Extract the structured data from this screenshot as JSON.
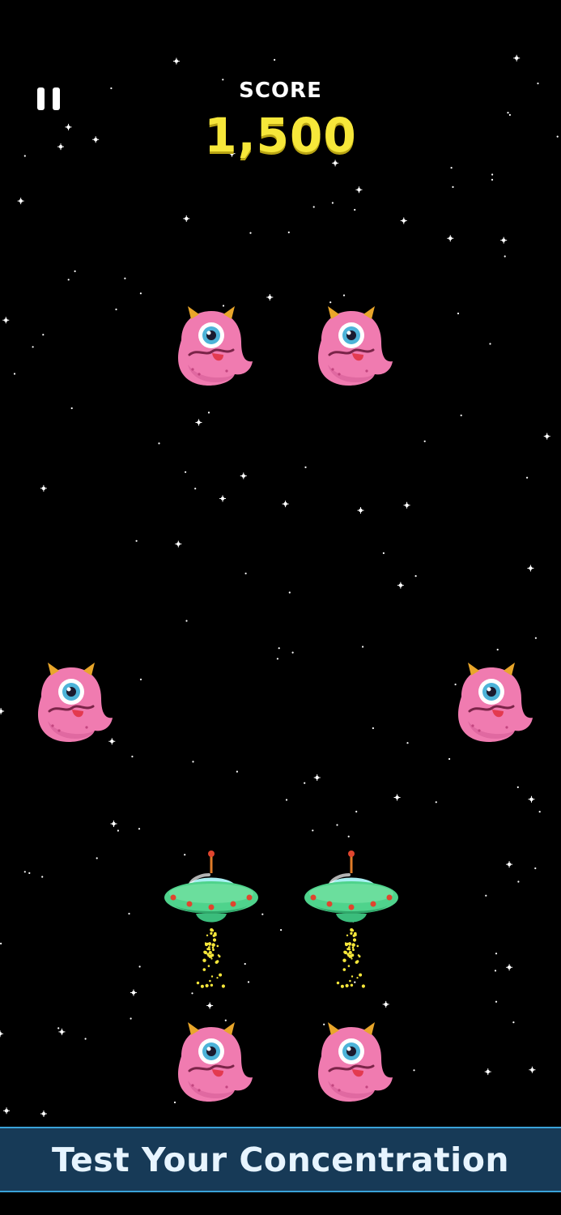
{
  "hud": {
    "score_label": "SCORE",
    "score_value": "1,500",
    "pause_icon": "pause-icon"
  },
  "banner": {
    "text": "Test Your Concentration"
  },
  "sprites": {
    "monster_icon": "one-eyed-pink-monster-icon",
    "ufo_icon": "green-ufo-icon"
  },
  "colors": {
    "background": "#000000",
    "score": "#f6e73a",
    "monster": "#f07bb0",
    "ufo": "#4fd38c",
    "banner": "#173a57"
  }
}
